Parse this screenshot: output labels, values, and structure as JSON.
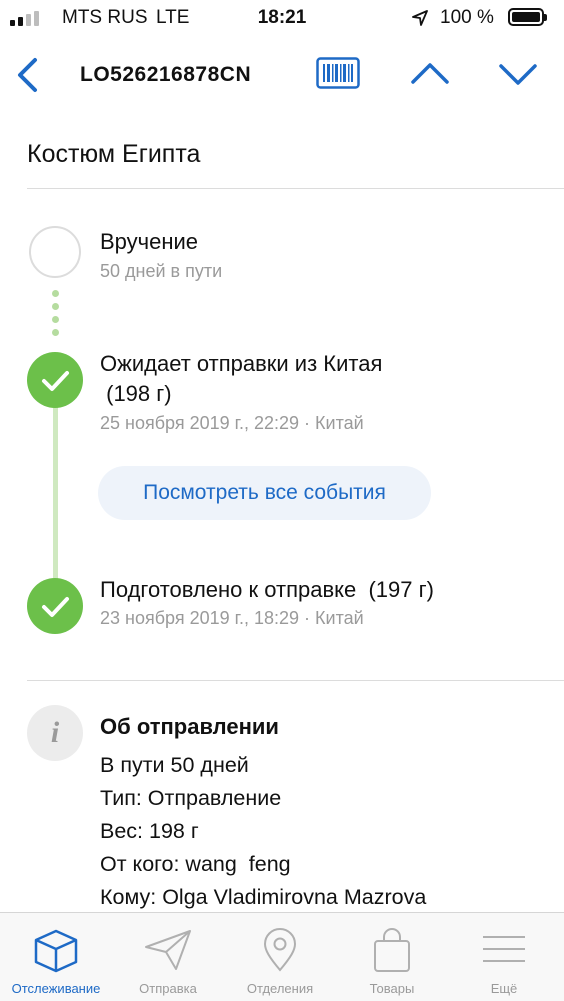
{
  "status_bar": {
    "carrier": "MTS RUS",
    "network": "LTE",
    "time": "18:21",
    "battery_percent": "100 %",
    "battery_level": 1.0
  },
  "nav": {
    "tracking_number": "LO526216878CN",
    "icons": [
      "back-chevron-icon",
      "barcode-icon",
      "chevron-up-icon",
      "chevron-down-icon"
    ]
  },
  "parcel": {
    "title": "Костюм Египта"
  },
  "timeline": {
    "delivery": {
      "title": "Вручение",
      "subtitle": "50 дней в пути"
    },
    "events": [
      {
        "title_line1": "Ожидает отправки из Китая",
        "title_line2": " (198 г)",
        "meta": "25 ноября 2019 г., 22:29 · Китай"
      },
      {
        "title_line1": "Подготовлено к отправке  (197 г)",
        "meta": "23 ноября 2019 г., 18:29 · Китай"
      }
    ],
    "view_all_label": "Посмотреть все события"
  },
  "info": {
    "heading": "Об отправлении",
    "icon_glyph": "i",
    "lines": [
      "В пути 50 дней",
      "Тип: Отправление",
      "Вес: 198 г",
      "От кого: wang  feng",
      "Кому: Olga Vladimirovna Mazrova"
    ]
  },
  "tabbar": {
    "tabs": [
      {
        "label": "Отслеживание",
        "active": true
      },
      {
        "label": "Отправка",
        "active": false
      },
      {
        "label": "Отделения",
        "active": false
      },
      {
        "label": "Товары",
        "active": false
      },
      {
        "label": "Ещё",
        "active": false
      }
    ]
  },
  "colors": {
    "accent_blue": "#1e6ac6",
    "success_green": "#6cc04a",
    "muted_gray": "#9a9a9a",
    "button_bg": "#eef3fa"
  }
}
